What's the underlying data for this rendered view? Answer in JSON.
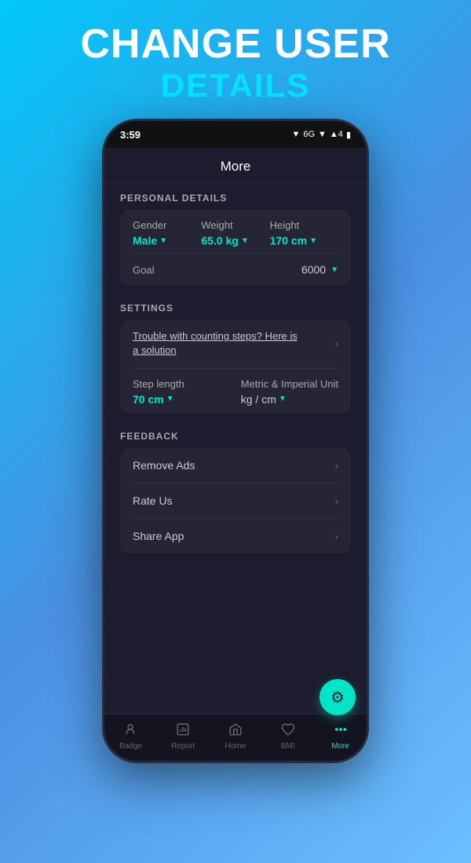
{
  "header": {
    "line1": "CHANGE USER",
    "line2": "DETAILS"
  },
  "statusBar": {
    "time": "3:59",
    "icons": "▼ ▲ 6G ▼ 4 🔋"
  },
  "appBar": {
    "title": "More"
  },
  "personalDetails": {
    "sectionLabel": "PERSONAL DETAILS",
    "gender": {
      "label": "Gender",
      "value": "Male"
    },
    "weight": {
      "label": "Weight",
      "value": "65.0 kg"
    },
    "height": {
      "label": "Height",
      "value": "170 cm"
    },
    "goal": {
      "label": "Goal",
      "value": "6000"
    }
  },
  "settings": {
    "sectionLabel": "SETTINGS",
    "troubleText": "Trouble with counting steps? Here is a solution",
    "stepLength": {
      "label": "Step length",
      "value": "70 cm"
    },
    "unit": {
      "label": "Metric & Imperial Unit",
      "value": "kg / cm"
    }
  },
  "feedback": {
    "sectionLabel": "FEEDBACK",
    "items": [
      {
        "label": "Remove Ads"
      },
      {
        "label": "Rate Us"
      },
      {
        "label": "Share App"
      }
    ]
  },
  "bottomNav": {
    "items": [
      {
        "label": "Badge",
        "icon": "👤"
      },
      {
        "label": "Report",
        "icon": "📊"
      },
      {
        "label": "Home",
        "icon": "🏠"
      },
      {
        "label": "BMI",
        "icon": "♡"
      },
      {
        "label": "More",
        "icon": "⋯"
      }
    ]
  },
  "fab": {
    "icon": "⚙"
  },
  "colors": {
    "accent": "#00e5c8",
    "background": "#1c1c2e",
    "card": "#252535"
  }
}
